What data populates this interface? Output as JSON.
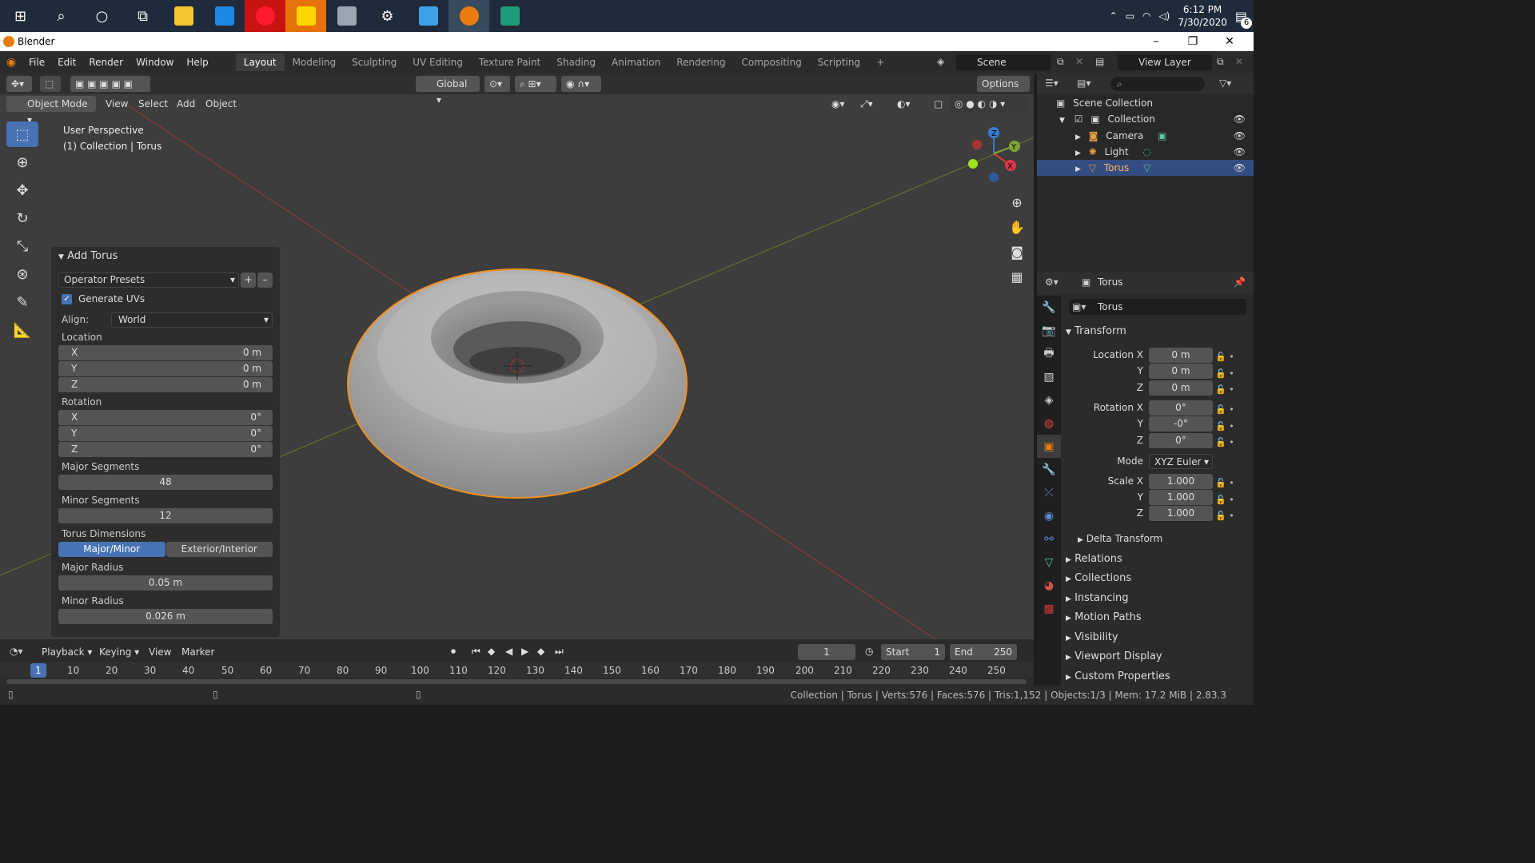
{
  "taskbar": {
    "time": "6:12 PM",
    "date": "7/30/2020",
    "notification_count": "6"
  },
  "window": {
    "title": "Blender"
  },
  "menu": {
    "items": [
      "File",
      "Edit",
      "Render",
      "Window",
      "Help"
    ]
  },
  "workspaces": {
    "tabs": [
      "Layout",
      "Modeling",
      "Sculpting",
      "UV Editing",
      "Texture Paint",
      "Shading",
      "Animation",
      "Rendering",
      "Compositing",
      "Scripting"
    ],
    "add": "+"
  },
  "scene": {
    "name": "Scene",
    "view_layer": "View Layer"
  },
  "viewport_header": {
    "transform_orientation": "Global",
    "options": "Options",
    "mode": "Object Mode",
    "menus": [
      "View",
      "Select",
      "Add",
      "Object"
    ]
  },
  "viewport": {
    "perspective": "User Perspective",
    "context": "(1) Collection | Torus"
  },
  "operator_panel": {
    "title": "Add Torus",
    "presets": "Operator Presets",
    "generate_uvs": "Generate UVs",
    "align_label": "Align:",
    "align_value": "World",
    "location_label": "Location",
    "location": [
      {
        "axis": "X",
        "value": "0 m"
      },
      {
        "axis": "Y",
        "value": "0 m"
      },
      {
        "axis": "Z",
        "value": "0 m"
      }
    ],
    "rotation_label": "Rotation",
    "rotation": [
      {
        "axis": "X",
        "value": "0°"
      },
      {
        "axis": "Y",
        "value": "0°"
      },
      {
        "axis": "Z",
        "value": "0°"
      }
    ],
    "major_segments_label": "Major Segments",
    "major_segments": "48",
    "minor_segments_label": "Minor Segments",
    "minor_segments": "12",
    "dimensions_label": "Torus Dimensions",
    "dim_mode_a": "Major/Minor",
    "dim_mode_b": "Exterior/Interior",
    "major_radius_label": "Major Radius",
    "major_radius": "0.05 m",
    "minor_radius_label": "Minor Radius",
    "minor_radius": "0.026 m"
  },
  "outliner": {
    "scene_collection": "Scene Collection",
    "collection": "Collection",
    "items": [
      "Camera",
      "Light",
      "Torus"
    ]
  },
  "properties": {
    "object_name": "Torus",
    "data_name": "Torus",
    "transform": "Transform",
    "location_x_label": "Location X",
    "rotation_x_label": "Rotation X",
    "scale_x_label": "Scale X",
    "y_label": "Y",
    "z_label": "Z",
    "location": [
      "0 m",
      "0 m",
      "0 m"
    ],
    "rotation": [
      "0°",
      "-0°",
      "0°"
    ],
    "mode_label": "Mode",
    "mode_value": "XYZ Euler",
    "scale": [
      "1.000",
      "1.000",
      "1.000"
    ],
    "delta_transform": "Delta Transform",
    "sections": [
      "Relations",
      "Collections",
      "Instancing",
      "Motion Paths",
      "Visibility",
      "Viewport Display",
      "Custom Properties"
    ]
  },
  "timeline": {
    "menus": [
      "Playback",
      "Keying",
      "View",
      "Marker"
    ],
    "current_frame": "1",
    "start_label": "Start",
    "start": "1",
    "end_label": "End",
    "end": "250",
    "ticks": [
      "1",
      "10",
      "20",
      "30",
      "40",
      "50",
      "60",
      "70",
      "80",
      "90",
      "100",
      "110",
      "120",
      "130",
      "140",
      "150",
      "160",
      "170",
      "180",
      "190",
      "200",
      "210",
      "220",
      "230",
      "240",
      "250"
    ]
  },
  "statusbar": {
    "stats": "Collection | Torus | Verts:576 | Faces:576 | Tris:1,152 | Objects:1/3 | Mem: 17.2 MiB | 2.83.3"
  }
}
